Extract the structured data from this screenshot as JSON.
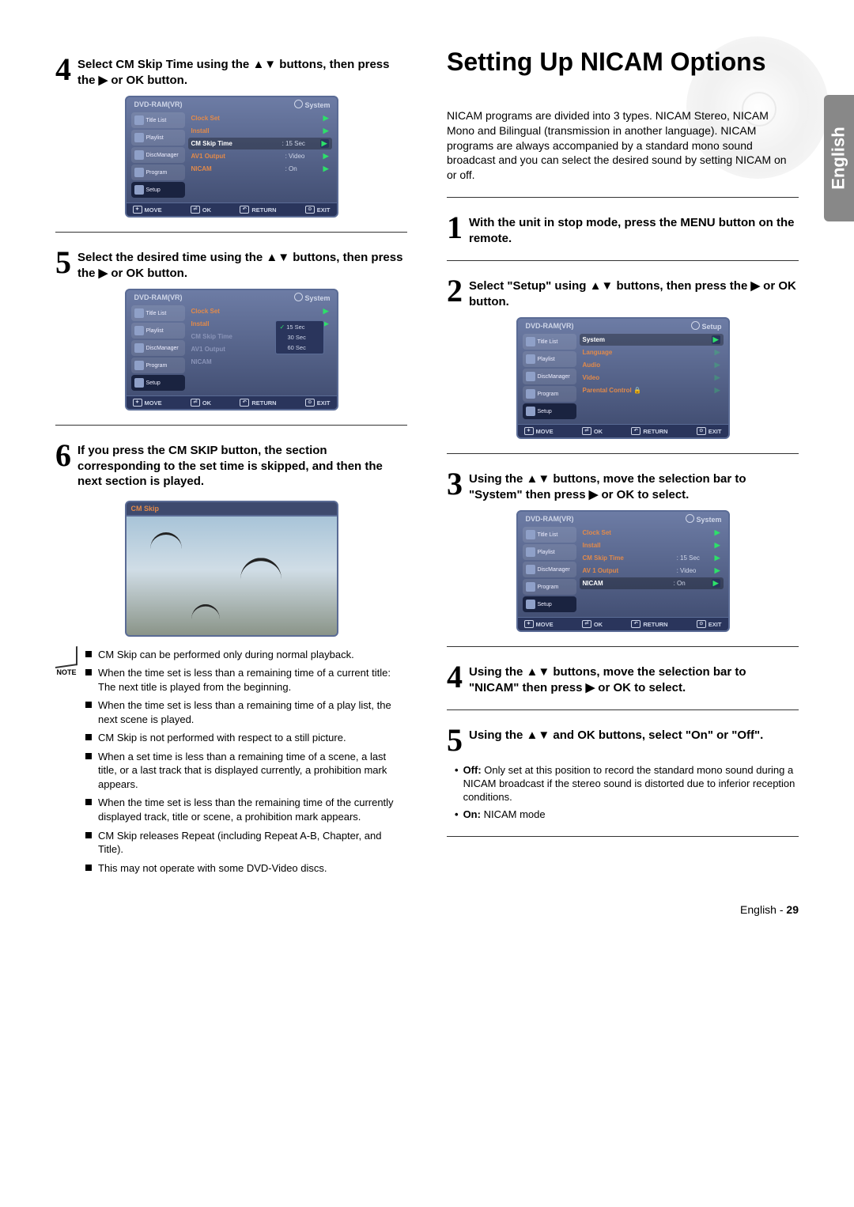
{
  "lang_tab": "English",
  "left": {
    "step4": "Select CM Skip Time using the ▲▼ buttons, then press the ▶ or OK button.",
    "step5": "Select the desired time using the ▲▼ buttons, then press the ▶ or OK button.",
    "step6": "If you press the CM SKIP button, the section corresponding to the set time is skipped, and then the next section is played.",
    "note_label": "NOTE",
    "notes": [
      "CM Skip can be performed only during normal playback.",
      "When the time set is less than a remaining time of a current title: The next title is played from the beginning.",
      "When the time set is less than a remaining time of a play list, the next scene is played.",
      "CM Skip is not performed with respect to a still picture.",
      "When a set time is less than a remaining time of a scene, a last title, or a last track that is displayed currently, a prohibition mark appears.",
      "When the time set is less than the remaining time of the currently displayed track, title or scene, a prohibition mark appears.",
      "CM Skip releases Repeat (including Repeat A-B, Chapter, and Title).",
      "This may not operate with some DVD-Video discs."
    ],
    "osd1": {
      "title_l": "DVD-RAM(VR)",
      "title_r": "System",
      "side": [
        "Title List",
        "Playlist",
        "DiscManager",
        "Program",
        "Setup"
      ],
      "rows": [
        {
          "k": "Clock Set",
          "v": "",
          "sel": false
        },
        {
          "k": "Install",
          "v": "",
          "sel": false
        },
        {
          "k": "CM Skip Time",
          "v": ": 15 Sec",
          "sel": true
        },
        {
          "k": "AV1 Output",
          "v": ": Video",
          "sel": false
        },
        {
          "k": "NICAM",
          "v": ": On",
          "sel": false
        }
      ],
      "footer": [
        "MOVE",
        "OK",
        "RETURN",
        "EXIT"
      ]
    },
    "osd2": {
      "title_l": "DVD-RAM(VR)",
      "title_r": "System",
      "side": [
        "Title List",
        "Playlist",
        "DiscManager",
        "Program",
        "Setup"
      ],
      "rows": [
        {
          "k": "Clock Set",
          "v": "",
          "sel": false
        },
        {
          "k": "Install",
          "v": "",
          "sel": false
        },
        {
          "k": "CM Skip Time",
          "v": "",
          "sel": false,
          "dim": true
        },
        {
          "k": "AV1 Output",
          "v": "",
          "sel": false,
          "dim": true
        },
        {
          "k": "NICAM",
          "v": "",
          "sel": false,
          "dim": true
        }
      ],
      "popup": [
        {
          "label": "15 Sec",
          "checked": true
        },
        {
          "label": "30 Sec",
          "checked": false
        },
        {
          "label": "60 Sec",
          "checked": false
        }
      ],
      "footer": [
        "MOVE",
        "OK",
        "RETURN",
        "EXIT"
      ]
    },
    "scene_header": "CM Skip"
  },
  "right": {
    "title": "Setting Up NICAM Options",
    "intro": "NICAM programs are divided into 3 types. NICAM Stereo, NICAM Mono and Bilingual (transmission in another language). NICAM programs are always accompanied by a standard mono sound broadcast and you can select the desired sound by setting NICAM on or off.",
    "step1": "With the unit in stop mode, press the MENU button on the remote.",
    "step2": "Select \"Setup\" using ▲▼ buttons, then press the ▶ or OK button.",
    "step3": "Using the ▲▼ buttons, move the selection bar to \"System\" then press ▶ or OK to select.",
    "step4": "Using the ▲▼ buttons, move the selection bar to \"NICAM\" then press ▶ or OK to select.",
    "step5": "Using the ▲▼ and OK buttons, select \"On\" or \"Off\".",
    "step5_sub": [
      {
        "b": "Off:",
        "t": " Only set at this position to record the standard mono sound during a NICAM broadcast if the stereo sound is distorted due to inferior reception conditions."
      },
      {
        "b": "On:",
        "t": " NICAM mode"
      }
    ],
    "osd_setup": {
      "title_l": "DVD-RAM(VR)",
      "title_r": "Setup",
      "side": [
        "Title List",
        "Playlist",
        "DiscManager",
        "Program",
        "Setup"
      ],
      "rows": [
        {
          "k": "System",
          "v": "",
          "sel": true
        },
        {
          "k": "Language",
          "v": "",
          "sel": false
        },
        {
          "k": "Audio",
          "v": "",
          "sel": false
        },
        {
          "k": "Video",
          "v": "",
          "sel": false
        },
        {
          "k": "Parental Control 🔒",
          "v": "",
          "sel": false
        }
      ],
      "footer": [
        "MOVE",
        "OK",
        "RETURN",
        "EXIT"
      ]
    },
    "osd_system": {
      "title_l": "DVD-RAM(VR)",
      "title_r": "System",
      "side": [
        "Title List",
        "Playlist",
        "DiscManager",
        "Program",
        "Setup"
      ],
      "rows": [
        {
          "k": "Clock Set",
          "v": "",
          "sel": false
        },
        {
          "k": "Install",
          "v": "",
          "sel": false
        },
        {
          "k": "CM Skip Time",
          "v": ": 15 Sec",
          "sel": false
        },
        {
          "k": "AV 1 Output",
          "v": ": Video",
          "sel": false
        },
        {
          "k": "NICAM",
          "v": ": On",
          "sel": true
        }
      ],
      "footer": [
        "MOVE",
        "OK",
        "RETURN",
        "EXIT"
      ]
    }
  },
  "footer": {
    "lang": "English",
    "page": "29"
  }
}
